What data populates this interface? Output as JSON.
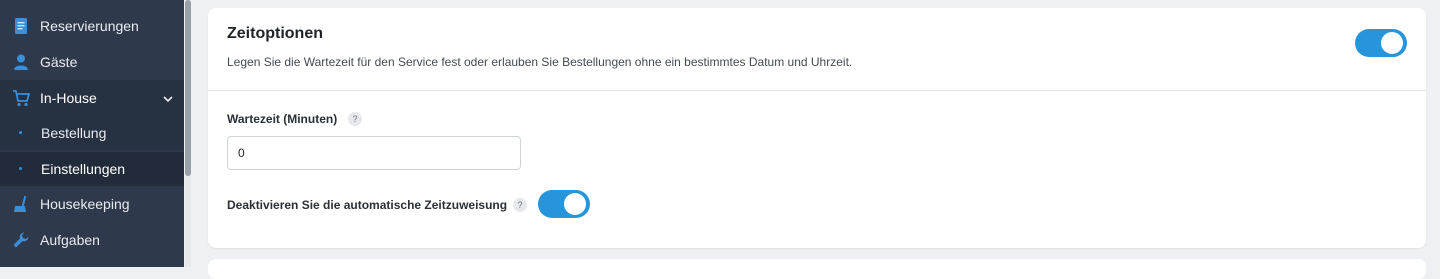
{
  "sidebar": {
    "items": [
      {
        "label": "Reservierungen",
        "icon": "document-icon"
      },
      {
        "label": "Gäste",
        "icon": "person-icon"
      },
      {
        "label": "In-House",
        "icon": "cart-icon",
        "expanded": true
      },
      {
        "label": "Housekeeping",
        "icon": "broom-icon"
      },
      {
        "label": "Aufgaben",
        "icon": "wrench-icon"
      }
    ],
    "subitems": [
      {
        "label": "Bestellung"
      },
      {
        "label": "Einstellungen",
        "selected": true
      }
    ]
  },
  "card": {
    "title": "Zeitoptionen",
    "description": "Legen Sie die Wartezeit für den Service fest oder erlauben Sie Bestellungen ohne ein bestimmtes Datum und Uhrzeit.",
    "enabled": true,
    "wait_label": "Wartezeit (Minuten)",
    "wait_value": "0",
    "auto_label": "Deaktivieren Sie die automatische Zeitzuweisung",
    "auto_enabled": true,
    "help_glyph": "?"
  },
  "colors": {
    "sidebar_bg": "#2e3a4c",
    "accent": "#2795d9",
    "background": "#eef0f3"
  }
}
